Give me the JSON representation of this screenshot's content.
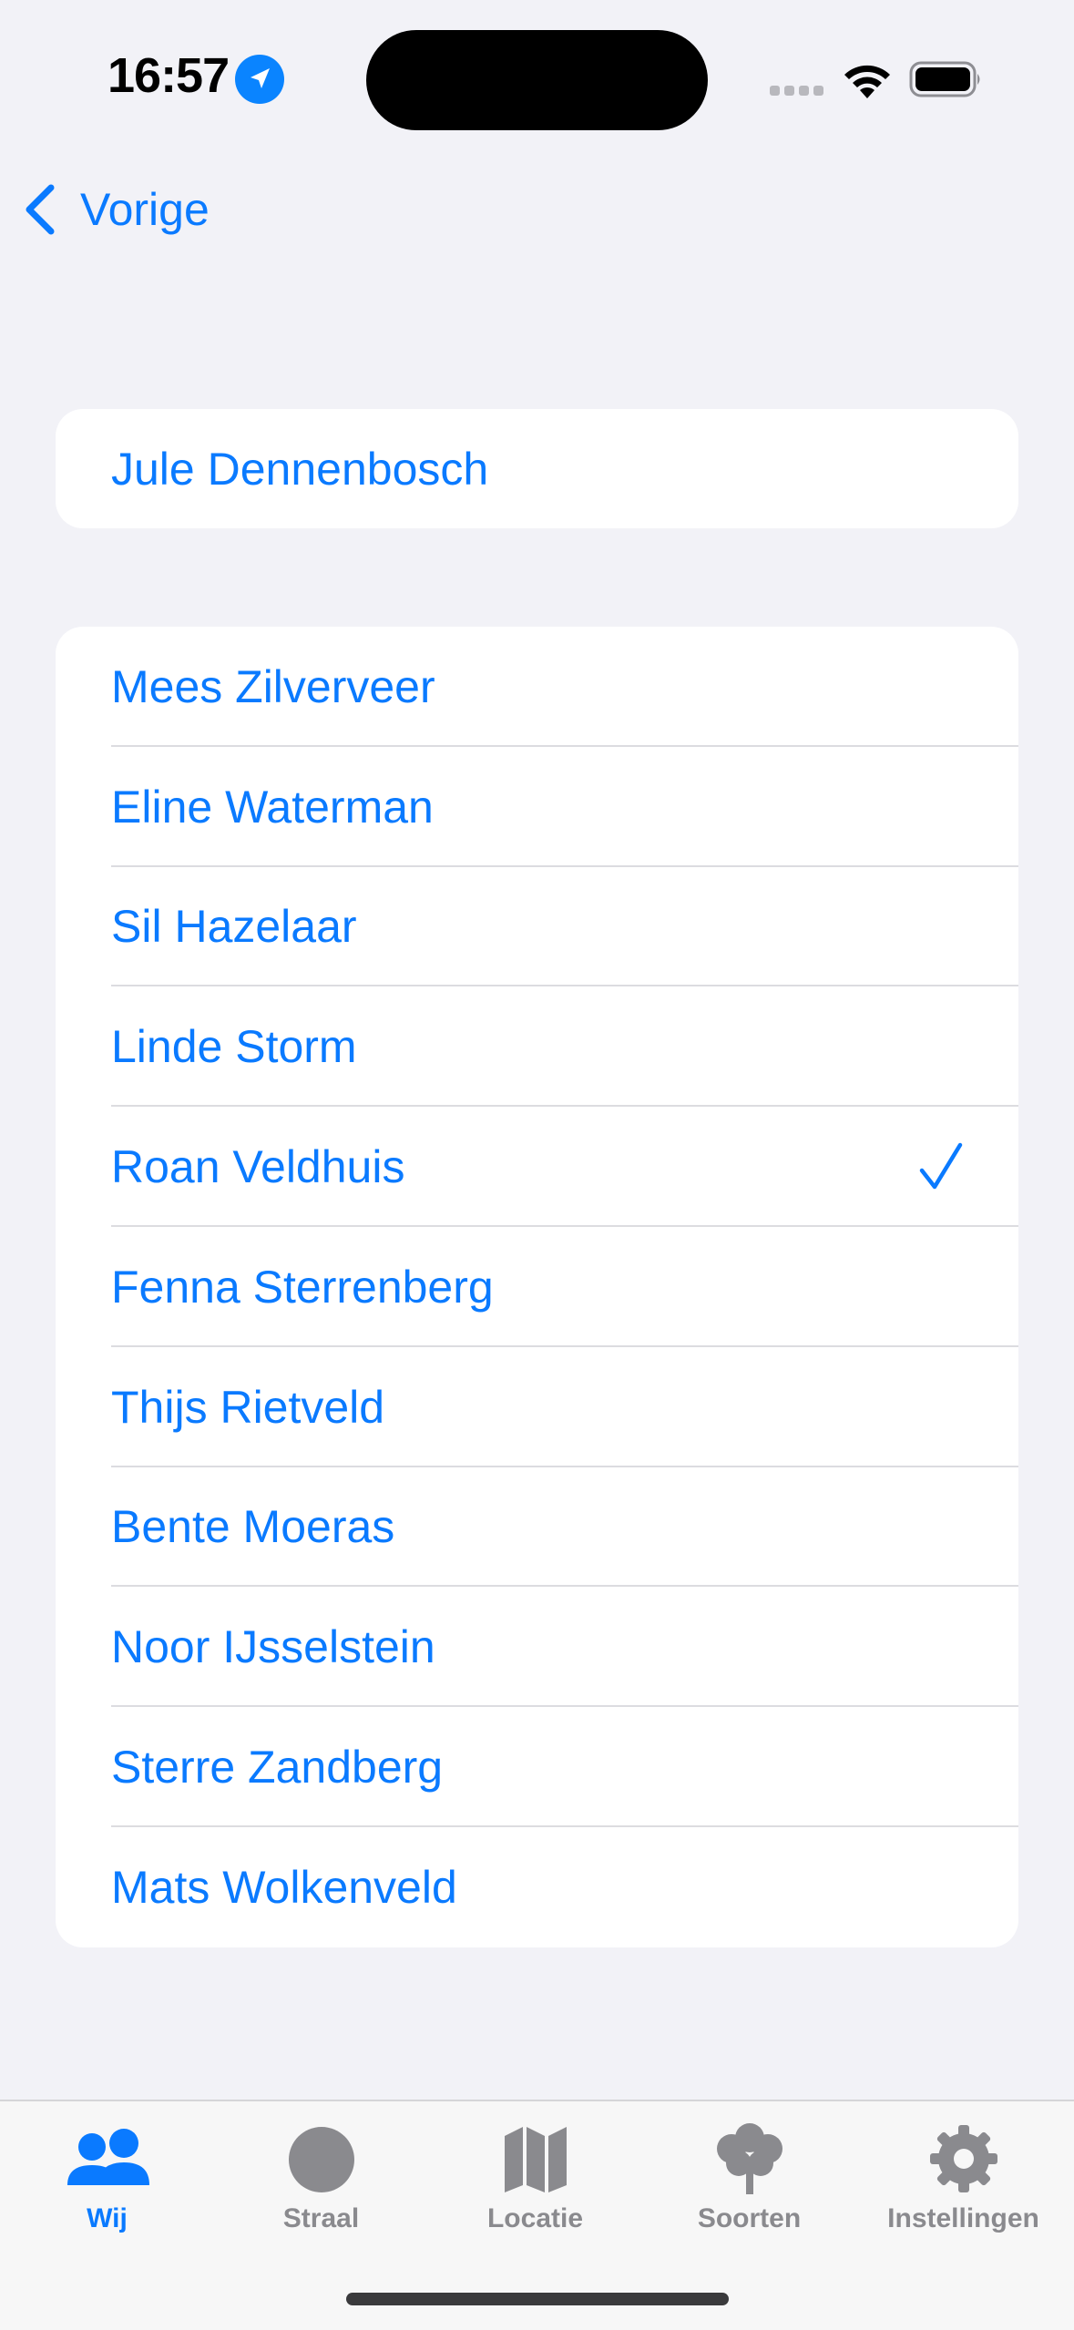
{
  "status_bar": {
    "time": "16:57"
  },
  "nav": {
    "back_label": "Vorige"
  },
  "selected_section": {
    "name": "Jule Dennenbosch"
  },
  "people": [
    {
      "name": "Mees Zilverveer",
      "checked": false
    },
    {
      "name": "Eline Waterman",
      "checked": false
    },
    {
      "name": "Sil Hazelaar",
      "checked": false
    },
    {
      "name": "Linde Storm",
      "checked": false
    },
    {
      "name": "Roan Veldhuis",
      "checked": true
    },
    {
      "name": "Fenna Sterrenberg",
      "checked": false
    },
    {
      "name": "Thijs Rietveld",
      "checked": false
    },
    {
      "name": "Bente Moeras",
      "checked": false
    },
    {
      "name": "Noor IJsselstein",
      "checked": false
    },
    {
      "name": "Sterre Zandberg",
      "checked": false
    },
    {
      "name": "Mats Wolkenveld",
      "checked": false
    }
  ],
  "tabbar": {
    "tabs": [
      {
        "label": "Wij",
        "icon": "people-icon",
        "active": true
      },
      {
        "label": "Straal",
        "icon": "circle-icon",
        "active": false
      },
      {
        "label": "Locatie",
        "icon": "map-icon",
        "active": false
      },
      {
        "label": "Soorten",
        "icon": "tree-icon",
        "active": false
      },
      {
        "label": "Instellingen",
        "icon": "gear-icon",
        "active": false
      }
    ]
  },
  "colors": {
    "accent": "#0a7aff",
    "background": "#f2f2f7",
    "inactive_tab": "#8a8a8e"
  }
}
